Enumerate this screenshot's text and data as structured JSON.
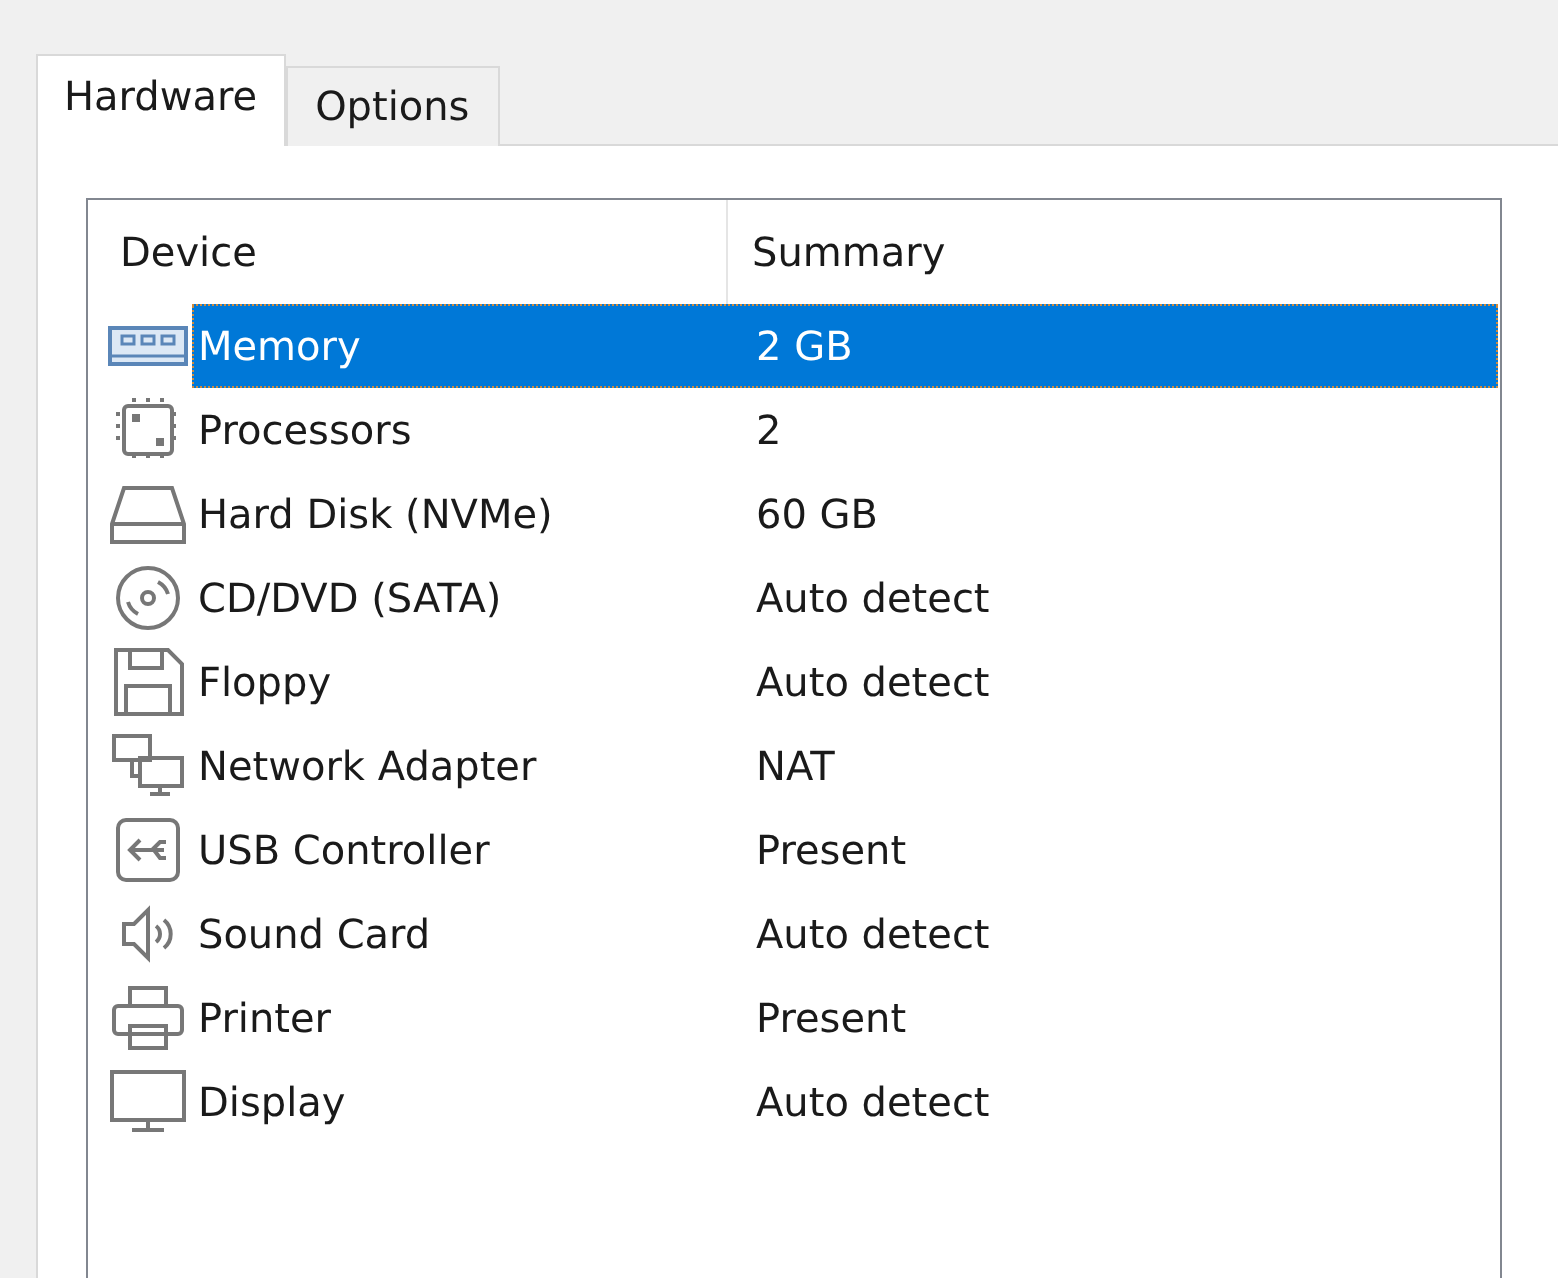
{
  "tabs": [
    {
      "label": "Hardware",
      "selected": true
    },
    {
      "label": "Options",
      "selected": false
    }
  ],
  "table": {
    "columns": [
      "Device",
      "Summary"
    ],
    "rows": [
      {
        "kind": "memory",
        "device": "Memory",
        "summary": "2 GB",
        "selected": true
      },
      {
        "kind": "processor",
        "device": "Processors",
        "summary": "2",
        "selected": false
      },
      {
        "kind": "disk",
        "device": "Hard Disk (NVMe)",
        "summary": "60 GB",
        "selected": false
      },
      {
        "kind": "cd",
        "device": "CD/DVD (SATA)",
        "summary": "Auto detect",
        "selected": false
      },
      {
        "kind": "floppy",
        "device": "Floppy",
        "summary": "Auto detect",
        "selected": false
      },
      {
        "kind": "network",
        "device": "Network Adapter",
        "summary": "NAT",
        "selected": false
      },
      {
        "kind": "usb",
        "device": "USB Controller",
        "summary": "Present",
        "selected": false
      },
      {
        "kind": "sound",
        "device": "Sound Card",
        "summary": "Auto detect",
        "selected": false
      },
      {
        "kind": "printer",
        "device": "Printer",
        "summary": "Present",
        "selected": false
      },
      {
        "kind": "display",
        "device": "Display",
        "summary": "Auto detect",
        "selected": false
      }
    ]
  }
}
